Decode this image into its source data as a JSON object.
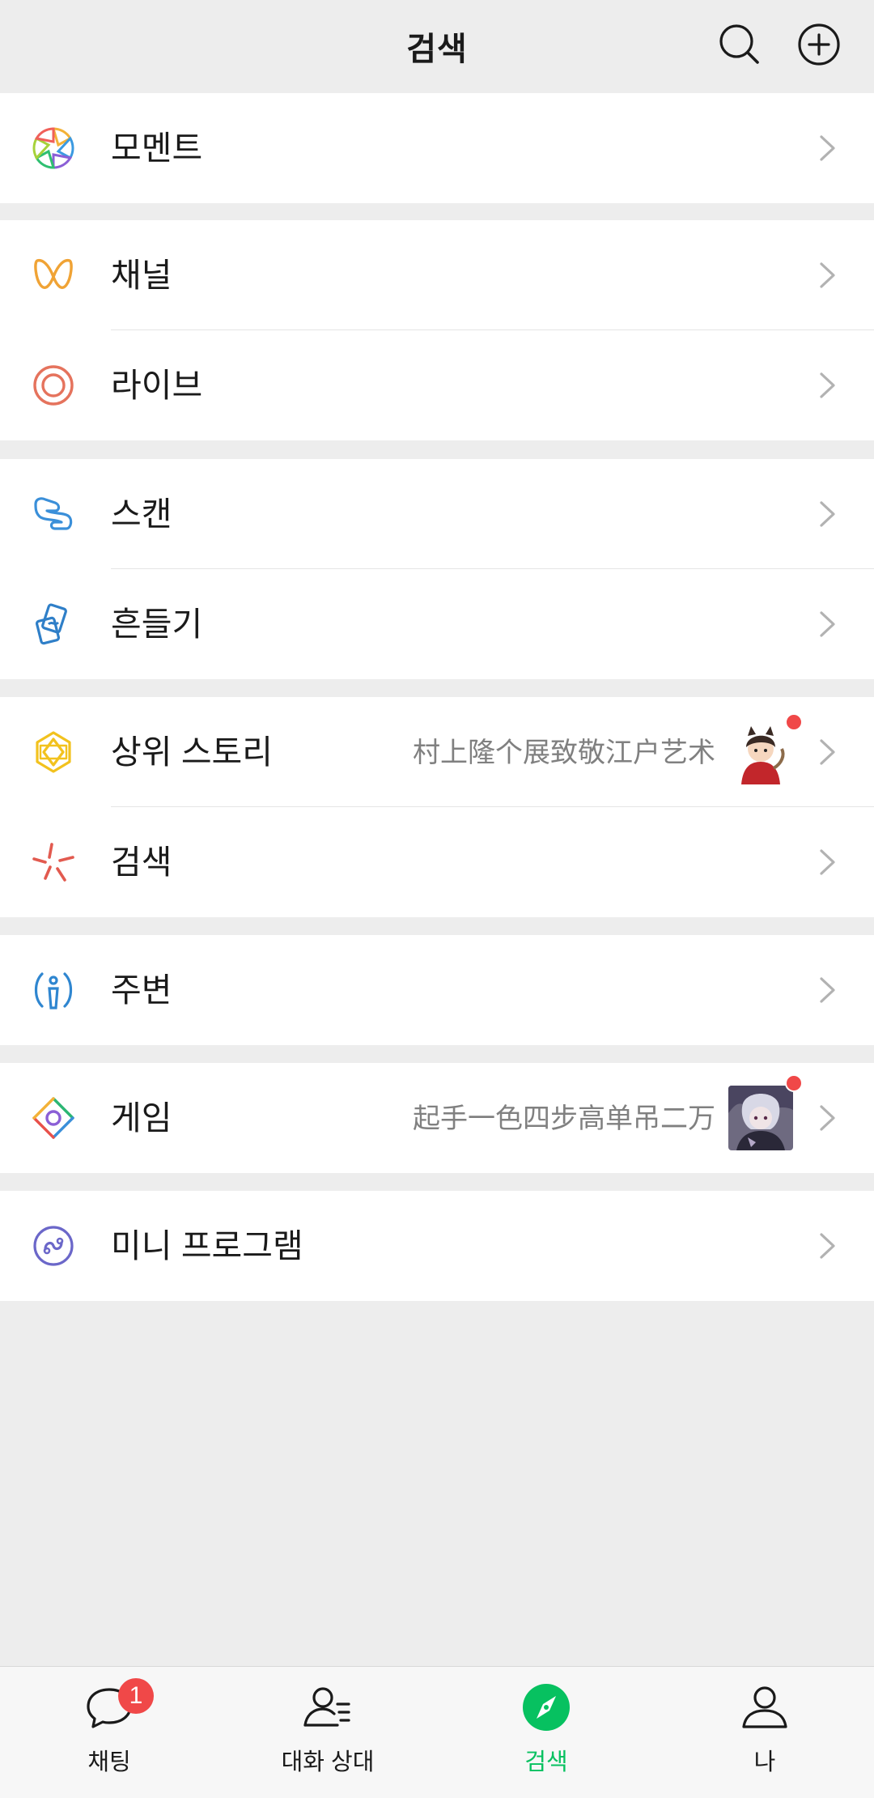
{
  "header": {
    "title": "검색",
    "search_icon": "search-icon",
    "add_icon": "plus-circle-icon"
  },
  "groups": [
    {
      "items": [
        {
          "label": "모멘트",
          "icon": "moments-aperture-icon"
        }
      ]
    },
    {
      "items": [
        {
          "label": "채널",
          "icon": "channels-icon"
        },
        {
          "label": "라이브",
          "icon": "live-icon"
        }
      ]
    },
    {
      "items": [
        {
          "label": "스캔",
          "icon": "scan-icon"
        },
        {
          "label": "흔들기",
          "icon": "shake-icon"
        }
      ]
    },
    {
      "items": [
        {
          "label": "상위 스토리",
          "icon": "top-stories-icon",
          "subtext": "村上隆个展致敬江户艺术",
          "has_thumbnail": true,
          "has_red_dot": true
        },
        {
          "label": "검색",
          "icon": "search-sparkle-icon"
        }
      ]
    },
    {
      "items": [
        {
          "label": "주변",
          "icon": "nearby-icon"
        }
      ]
    },
    {
      "items": [
        {
          "label": "게임",
          "icon": "games-icon",
          "subtext": "起手一色四步高单吊二万",
          "has_thumbnail": true,
          "has_red_dot": true
        }
      ]
    },
    {
      "items": [
        {
          "label": "미니 프로그램",
          "icon": "mini-programs-icon"
        }
      ]
    }
  ],
  "tabbar": {
    "tabs": [
      {
        "label": "채팅",
        "icon": "chat-bubble-icon",
        "badge": "1"
      },
      {
        "label": "대화 상대",
        "icon": "contacts-icon"
      },
      {
        "label": "검색",
        "icon": "discover-compass-icon",
        "active": true
      },
      {
        "label": "나",
        "icon": "me-person-icon"
      }
    ]
  },
  "colors": {
    "accent": "#07c160",
    "badge_red": "#f04848",
    "background": "#ededed"
  }
}
